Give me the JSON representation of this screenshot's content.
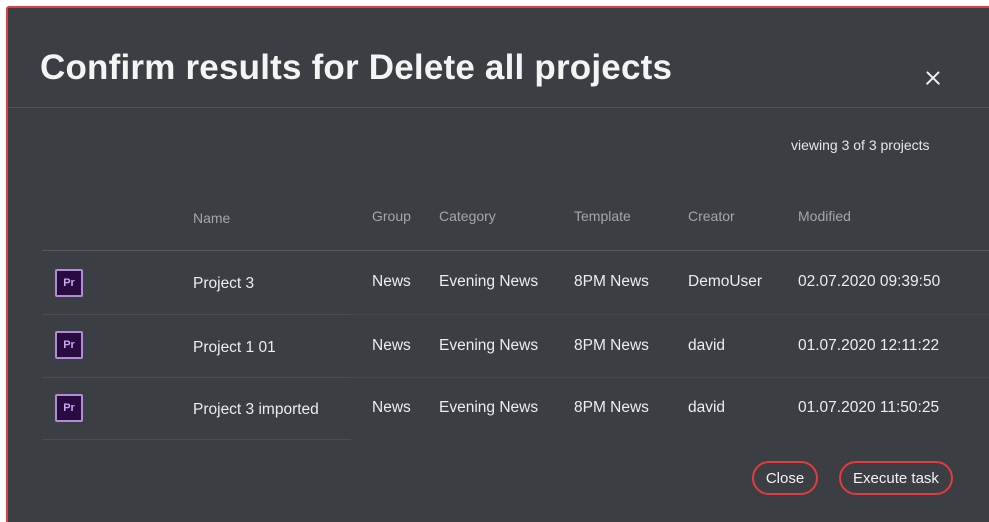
{
  "dialog": {
    "title": "Confirm results for Delete all projects",
    "close_icon": "close-icon",
    "count_text": "viewing 3 of 3 projects"
  },
  "table": {
    "headers": {
      "name": "Name",
      "group": "Group",
      "category": "Category",
      "template": "Template",
      "creator": "Creator",
      "modified": "Modified"
    },
    "rows": [
      {
        "icon": "premiere-pro-icon",
        "icon_text": "Pr",
        "name": "Project 3",
        "group": "News",
        "category": "Evening News",
        "template": "8PM News",
        "creator": "DemoUser",
        "modified": "02.07.2020 09:39:50"
      },
      {
        "icon": "premiere-pro-icon",
        "icon_text": "Pr",
        "name": "Project 1 01",
        "group": "News",
        "category": "Evening News",
        "template": "8PM News",
        "creator": "david",
        "modified": "01.07.2020 12:11:22"
      },
      {
        "icon": "premiere-pro-icon",
        "icon_text": "Pr",
        "name": "Project 3 imported",
        "group": "News",
        "category": "Evening News",
        "template": "8PM News",
        "creator": "david",
        "modified": "01.07.2020 11:50:25"
      }
    ]
  },
  "footer": {
    "close_label": "Close",
    "execute_label": "Execute task"
  },
  "colors": {
    "background": "#3b3e42",
    "accent_border": "#e53a40",
    "premiere_icon_bg": "#2a0b3f",
    "premiere_icon_border": "#b18cd6"
  }
}
